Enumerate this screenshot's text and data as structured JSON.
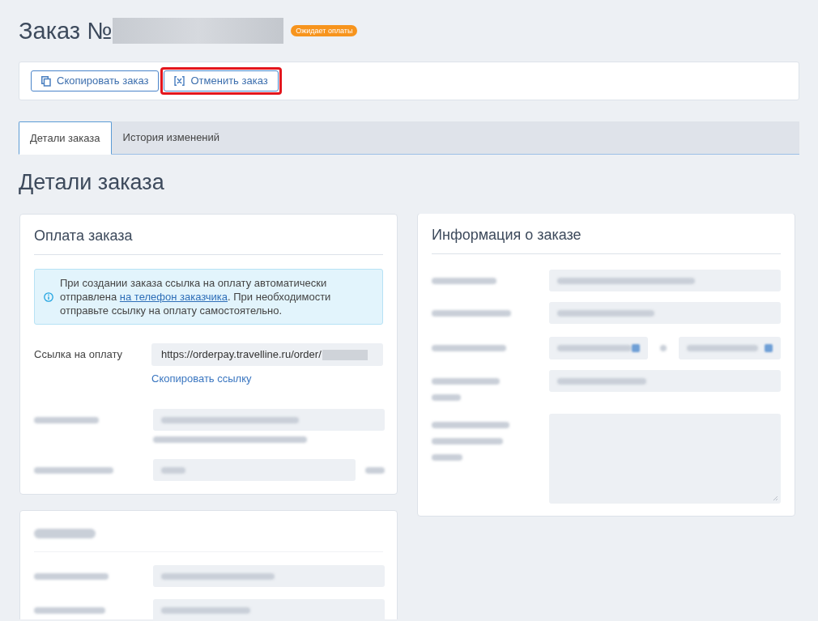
{
  "header": {
    "title": "Заказ №",
    "status_badge": "Ожидает оплаты"
  },
  "actions": [
    {
      "label": "Скопировать заказ",
      "kind": "copy",
      "highlighted": false
    },
    {
      "label": "Отменить заказ",
      "kind": "cancel",
      "highlighted": true
    }
  ],
  "tabs": [
    {
      "label": "Детали заказа",
      "selected": true
    },
    {
      "label": "История изменений",
      "selected": false
    }
  ],
  "page_heading": "Детали заказа",
  "payment": {
    "title": "Оплата заказа",
    "notice": {
      "text_before": "При создании заказа ссылка на оплату автоматически отправлена ",
      "link": "на телефон заказчика",
      "text_after": ". При необходимости отправьте ссылку на оплату самостоятельно."
    },
    "link_field": {
      "label": "Ссылка на оплату",
      "value": "https://orderpay.travelline.ru/order/",
      "action": "Скопировать ссылку"
    },
    "blurred_rows": [
      {
        "kind": "field_with_hint"
      },
      {
        "kind": "field_with_suffix"
      }
    ]
  },
  "customer": {
    "blurred_rows": [
      {
        "kind": "field"
      },
      {
        "kind": "field"
      }
    ]
  },
  "order_info": {
    "title": "Информация о заказе",
    "blurred_rows": [
      {
        "kind": "field"
      },
      {
        "kind": "field"
      },
      {
        "kind": "date_range"
      },
      {
        "kind": "two_line_field"
      },
      {
        "kind": "textarea"
      }
    ]
  }
}
